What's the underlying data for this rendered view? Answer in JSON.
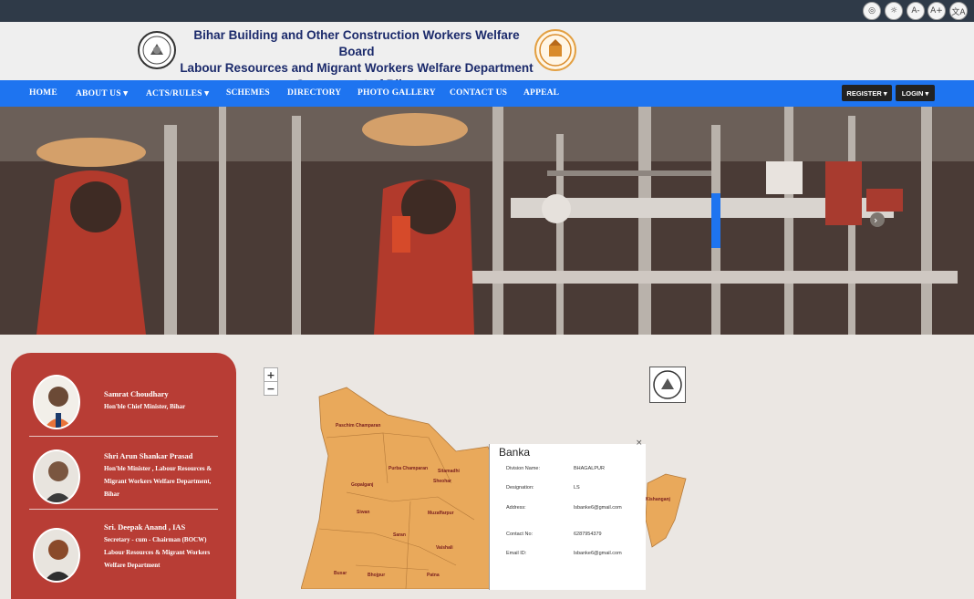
{
  "accessibility": {
    "buttons": [
      "◎",
      "☼",
      "A-",
      "A+",
      "文A"
    ]
  },
  "header": {
    "line1": "Bihar Building and Other Construction Workers Welfare Board",
    "line2": "Labour Resources and Migrant Workers Welfare Department",
    "line3": "Government of Bihar"
  },
  "nav": {
    "items": [
      "HOME",
      "ABOUT US ▾",
      "ACTS/RULES ▾",
      "SCHEMES",
      "DIRECTORY",
      "PHOTO GALLERY",
      "CONTACT US",
      "APPEAL"
    ],
    "register": "REGISTER ▾",
    "login": "LOGIN ▾"
  },
  "banner": {
    "next_arrow": "›"
  },
  "officials": [
    {
      "name": "Samrat Choudhary",
      "role": "Hon'ble Chief Minister, Bihar"
    },
    {
      "name": "Shri Arun Shankar Prasad",
      "role": "Hon'ble Minister , Labour Resources & Migrant Workers Welfare Department, Bihar"
    },
    {
      "name": "Sri. Deepak Anand , IAS",
      "role": "Secretary - cum - Chairman (BOCW) Labour Resources & Migrant Workers Welfare Department"
    }
  ],
  "map": {
    "zoom_in": "+",
    "zoom_out": "−",
    "districts": [
      "Paschim Champaran",
      "Purba Champaran",
      "Sheohar",
      "Sitamadhi",
      "Gopalganj",
      "Siwan",
      "Muzaffarpur",
      "Saran",
      "Vaishali",
      "Buxar",
      "Bhojpur",
      "Patna",
      "Kishanganj"
    ],
    "popup": {
      "title": "Banka",
      "close": "×",
      "rows": [
        {
          "label": "Division Name:",
          "value": "BHAGALPUR"
        },
        {
          "label": "Designation:",
          "value": "LS"
        },
        {
          "label": "Address:",
          "value": "lsbanke6@gmail.com"
        },
        {
          "label": "Contact No:",
          "value": "6287954379"
        },
        {
          "label": "Email ID:",
          "value": "lsbanke6@gmail.com"
        }
      ]
    }
  },
  "colors": {
    "nav": "#1e74f0",
    "officials_panel": "#b83d35",
    "map_fill": "#e9a95b",
    "header_text": "#1b2a6b"
  }
}
